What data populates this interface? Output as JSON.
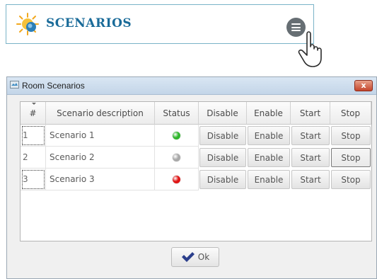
{
  "header": {
    "title": "SCENARIOS",
    "icon": "sun-scenario-icon",
    "menu_icon": "hamburger-menu-icon",
    "pointer_icon": "touch-hand-icon",
    "accent_color": "#1a6b99"
  },
  "dialog": {
    "title": "Room Scenarios",
    "close_label": "x",
    "table": {
      "columns": [
        "#",
        "Scenario description",
        "Status",
        "Disable",
        "Enable",
        "Start",
        "Stop"
      ],
      "rows": [
        {
          "num": "1",
          "description": "Scenario 1",
          "status": "green",
          "disable": "Disable",
          "enable": "Enable",
          "start": "Start",
          "stop": "Stop"
        },
        {
          "num": "2",
          "description": "Scenario 2",
          "status": "gray",
          "disable": "Disable",
          "enable": "Enable",
          "start": "Start",
          "stop": "Stop"
        },
        {
          "num": "3",
          "description": "Scenario 3",
          "status": "red",
          "disable": "Disable",
          "enable": "Enable",
          "start": "Start",
          "stop": "Stop"
        }
      ]
    },
    "ok_label": "Ok"
  },
  "status_colors": {
    "green": "#2fb62b",
    "gray": "#a8a8a8",
    "red": "#e01414"
  }
}
